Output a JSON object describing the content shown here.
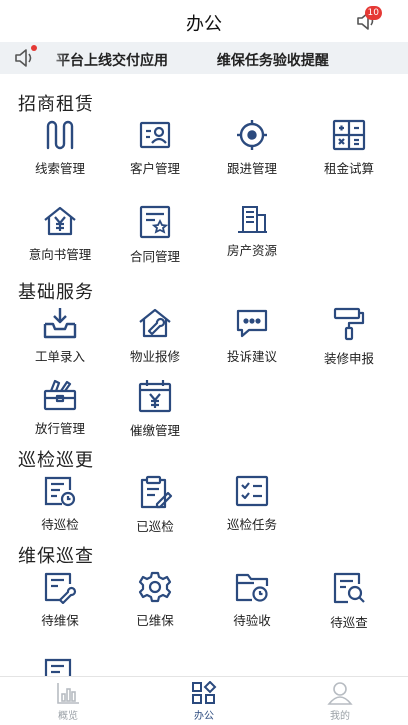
{
  "header": {
    "title": "办公",
    "badge_count": "10"
  },
  "notice": {
    "items": [
      "平台上线交付应用",
      "维保任务验收提醒"
    ]
  },
  "colors": {
    "icon": "#2b4a7e",
    "badge": "#e53935",
    "notice_bg": "#eef1f4"
  },
  "sections": [
    {
      "title": "招商租赁",
      "items": [
        {
          "label": "线索管理",
          "icon": "clue-icon"
        },
        {
          "label": "客户管理",
          "icon": "customer-card-icon"
        },
        {
          "label": "跟进管理",
          "icon": "target-icon"
        },
        {
          "label": "租金试算",
          "icon": "calculator-icon"
        },
        {
          "label": "意向书管理",
          "icon": "house-yen-icon"
        },
        {
          "label": "合同管理",
          "icon": "contract-icon"
        },
        {
          "label": "房产资源",
          "icon": "building-icon"
        }
      ]
    },
    {
      "title": "基础服务",
      "items": [
        {
          "label": "工单录入",
          "icon": "tray-download-icon"
        },
        {
          "label": "物业报修",
          "icon": "house-wrench-icon"
        },
        {
          "label": "投诉建议",
          "icon": "chat-bubble-icon"
        },
        {
          "label": "装修申报",
          "icon": "paint-roller-icon"
        },
        {
          "label": "放行管理",
          "icon": "toolbox-icon"
        },
        {
          "label": "催缴管理",
          "icon": "calendar-yen-icon"
        }
      ]
    },
    {
      "title": "巡检巡更",
      "items": [
        {
          "label": "待巡检",
          "icon": "doc-clock-icon"
        },
        {
          "label": "已巡检",
          "icon": "clipboard-pen-icon"
        },
        {
          "label": "巡检任务",
          "icon": "checklist-icon"
        }
      ]
    },
    {
      "title": "维保巡查",
      "items": [
        {
          "label": "待维保",
          "icon": "doc-wrench-icon"
        },
        {
          "label": "已维保",
          "icon": "gear-icon"
        },
        {
          "label": "待验收",
          "icon": "folder-clock-icon"
        },
        {
          "label": "待巡查",
          "icon": "doc-search-icon"
        }
      ]
    }
  ],
  "bottom_nav": [
    {
      "label": "概览",
      "icon": "bar-chart-icon",
      "active": false
    },
    {
      "label": "办公",
      "icon": "grid-icon",
      "active": true
    },
    {
      "label": "我的",
      "icon": "user-icon",
      "active": false
    }
  ]
}
